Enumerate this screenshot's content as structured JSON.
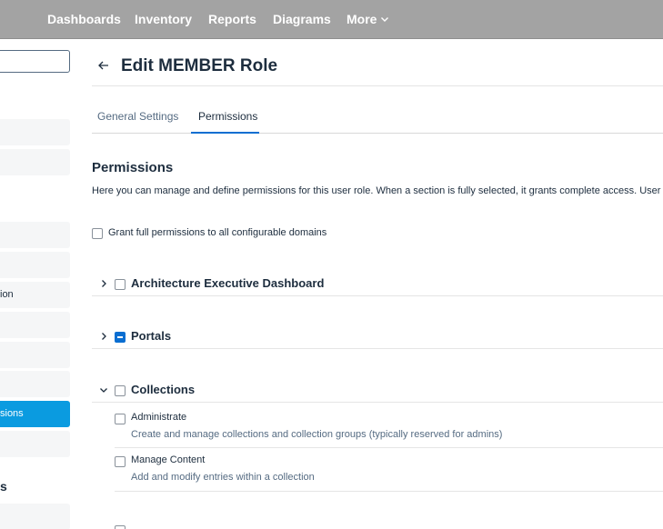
{
  "nav": {
    "items": [
      {
        "label": "Dashboards"
      },
      {
        "label": "Inventory"
      },
      {
        "label": "Reports"
      },
      {
        "label": "Diagrams"
      },
      {
        "label": "More"
      }
    ]
  },
  "sidebar": {
    "items": [
      {
        "label": ""
      },
      {
        "label": ""
      },
      {
        "label": ""
      },
      {
        "label": ""
      },
      {
        "label": "ion"
      },
      {
        "label": ""
      },
      {
        "label": ""
      },
      {
        "label": ""
      },
      {
        "label": "sions"
      },
      {
        "label": ""
      },
      {
        "label": ""
      }
    ],
    "group_label": "s"
  },
  "page": {
    "title": "Edit MEMBER Role",
    "tabs": [
      {
        "label": "General Settings"
      },
      {
        "label": "Permissions"
      }
    ]
  },
  "permissions": {
    "title": "Permissions",
    "description": "Here you can manage and define permissions for this user role. When a section is fully selected, it grants complete access. User",
    "grant_all_label": "Grant full permissions to all configurable domains",
    "groups": [
      {
        "title": "Architecture Executive Dashboard",
        "state": "unchecked",
        "expanded": false
      },
      {
        "title": "Portals",
        "state": "partial",
        "expanded": false
      },
      {
        "title": "Collections",
        "state": "unchecked",
        "expanded": true,
        "items": [
          {
            "name": "Administrate",
            "description": "Create and manage collections and collection groups (typically reserved for admins)"
          },
          {
            "name": "Manage Content",
            "description": "Add and modify entries within a collection"
          }
        ]
      }
    ]
  },
  "colors": {
    "topbar": "#a3a3a3",
    "accent": "#0a6ed1",
    "sidebar_active": "#0a9be0"
  }
}
